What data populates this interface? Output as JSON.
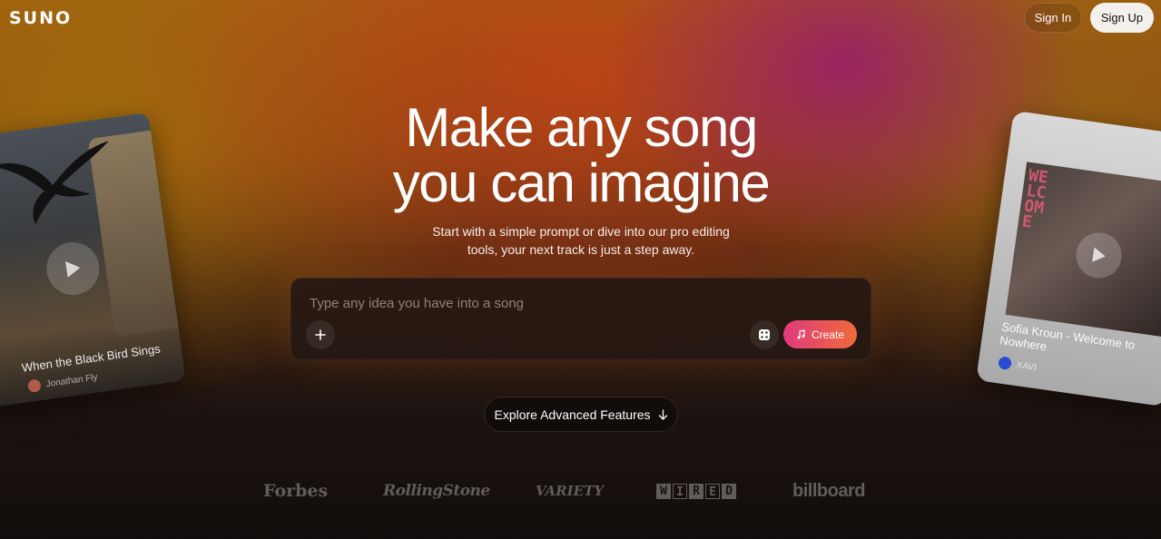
{
  "header": {
    "logo": "SUNO",
    "sign_in": "Sign In",
    "sign_up": "Sign Up"
  },
  "hero": {
    "title_line1": "Make any song",
    "title_line2": "you can imagine",
    "subtitle_line1": "Start with a simple prompt or dive into our pro editing",
    "subtitle_line2": "tools, your next track is just a step away."
  },
  "prompt": {
    "placeholder": "Type any idea you have into a song",
    "value": "",
    "add_icon": "plus-icon",
    "dice_icon": "dice-icon",
    "create_label": "Create",
    "create_icon": "music-sparkle-icon"
  },
  "explore": {
    "label": "Explore Advanced Features",
    "icon": "arrow-down-icon"
  },
  "press": {
    "forbes": "Forbes",
    "rolling_stone": "RollingStone",
    "variety": "VARIETY",
    "wired": [
      "W",
      "I",
      "R",
      "E",
      "D"
    ],
    "billboard": "billboard"
  },
  "cards": {
    "left": {
      "title": "When the Black Bird Sings",
      "artist": "Jonathan Fly"
    },
    "right": {
      "cover_text": "WELCOME",
      "title": "Sofia Kroun - Welcome to Nowhere",
      "artist": "XAVI"
    }
  },
  "colors": {
    "accent_start": "#e03a7e",
    "accent_end": "#f06a3a",
    "sign_up_bg": "#f4f1ed"
  }
}
